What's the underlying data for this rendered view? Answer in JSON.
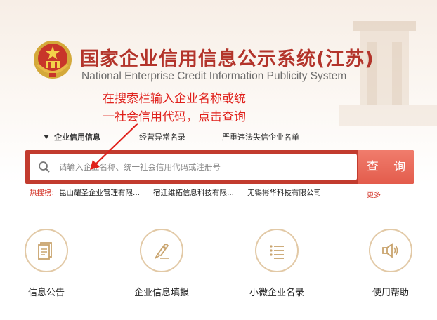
{
  "header": {
    "title_cn": "国家企业信用信息公示系统(江苏)",
    "title_en": "National Enterprise Credit Information Publicity System"
  },
  "annotation": {
    "line1": "在搜索栏输入企业名称或统",
    "line2": "一社会信用代码，点击查询"
  },
  "tabs": [
    {
      "label": "企业信用信息",
      "active": true
    },
    {
      "label": "经营异常名录",
      "active": false
    },
    {
      "label": "严重违法失信企业名单",
      "active": false
    }
  ],
  "search": {
    "placeholder": "请输入企业名称、统一社会信用代码或注册号",
    "button_label": "查 询"
  },
  "hot_search": {
    "label": "热搜榜:",
    "items": [
      "昆山耀圣企业管理有限...",
      "宿迁维拓信息科技有限...",
      "无锡彬华科技有限公司"
    ],
    "more_label": "更多"
  },
  "features": [
    {
      "label": "信息公告",
      "icon": "document-icon"
    },
    {
      "label": "企业信息填报",
      "icon": "pen-icon"
    },
    {
      "label": "小微企业名录",
      "icon": "list-icon"
    },
    {
      "label": "使用帮助",
      "icon": "speaker-icon"
    }
  ],
  "colors": {
    "brand_red": "#c23b2e",
    "title_red": "#b3342b",
    "annotation_red": "#e0201b",
    "gold": "#e2c9a6"
  }
}
